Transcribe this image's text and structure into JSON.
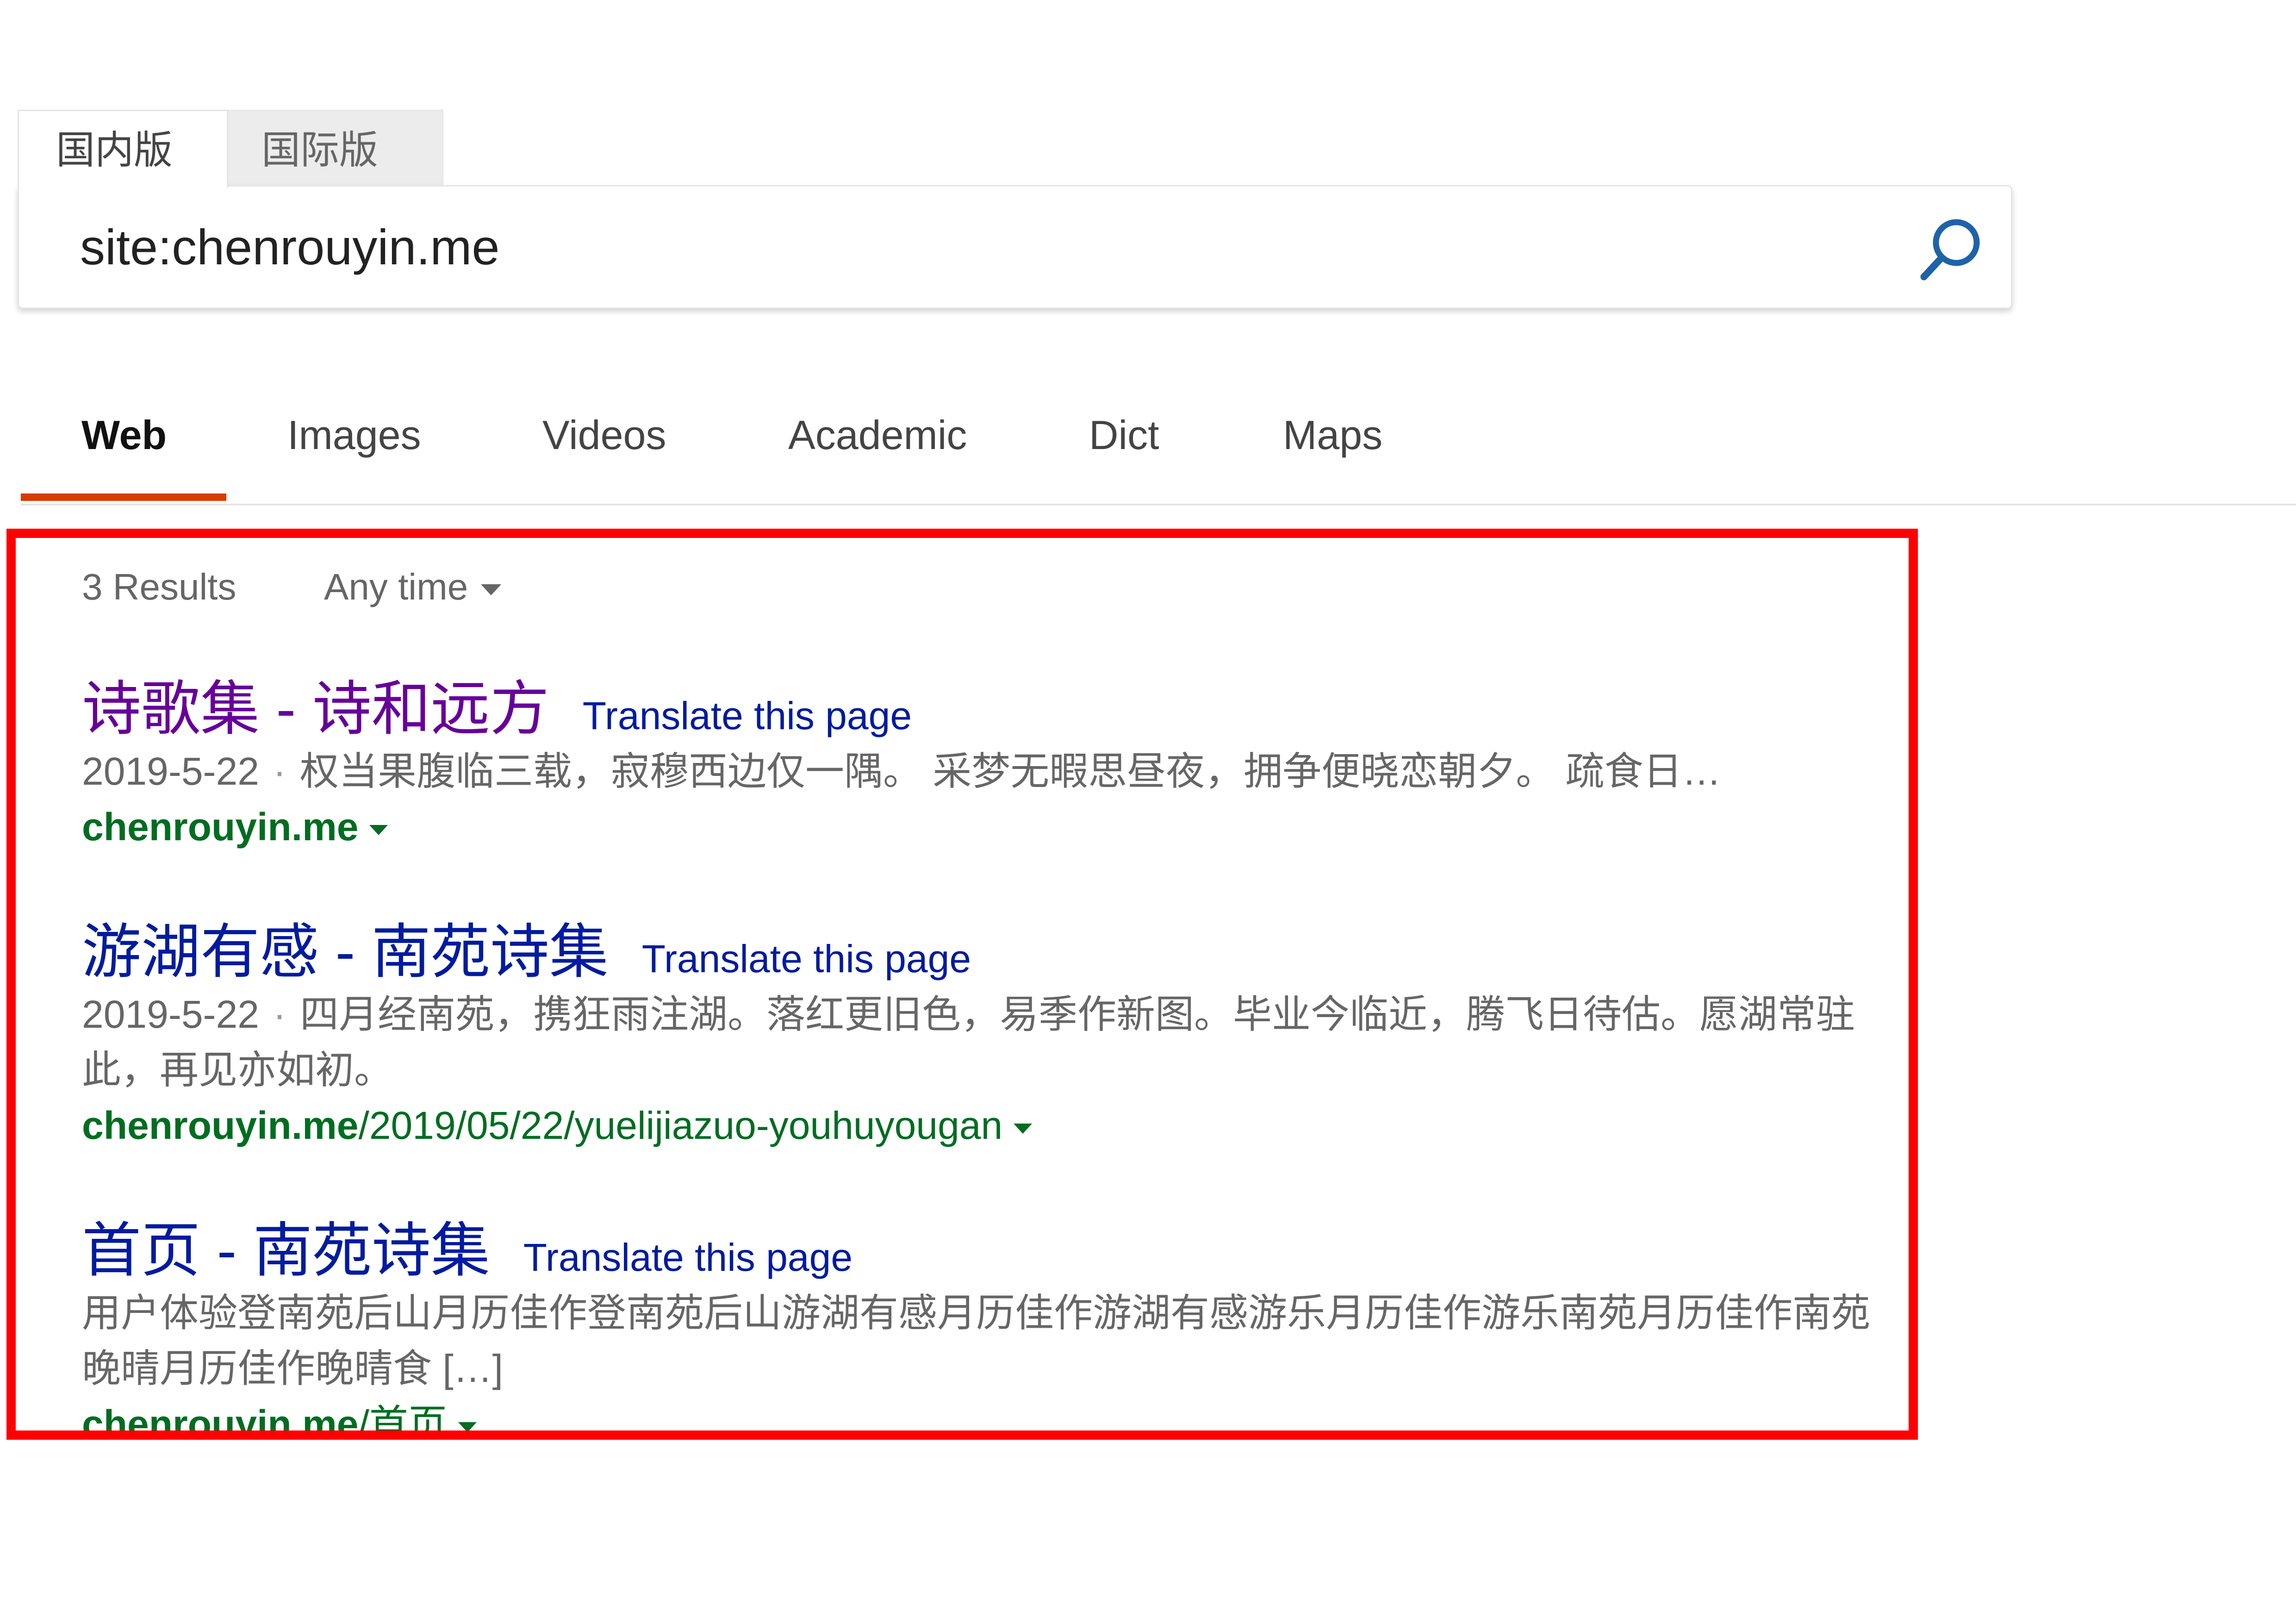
{
  "market_tabs": [
    {
      "label": "国内版",
      "active": true
    },
    {
      "label": "国际版",
      "active": false
    }
  ],
  "search": {
    "query": "site:chenrouyin.me",
    "icon": "search-icon"
  },
  "scope_nav": [
    "Web",
    "Images",
    "Videos",
    "Academic",
    "Dict",
    "Maps"
  ],
  "filters": {
    "count": "3 Results",
    "time": "Any time"
  },
  "results": [
    {
      "title": "诗歌集 - 诗和远方",
      "translate": "Translate this page",
      "date": "2019-5-22",
      "snippet": "权当果腹临三载，寂穆西边仅一隅。 采梦无暇思昼夜，拥争便晓恋朝夕。 疏食日…",
      "url_domain": "chenrouyin.me",
      "url_path": ""
    },
    {
      "title": "游湖有感 - 南苑诗集",
      "translate": "Translate this page",
      "date": "2019-5-22",
      "snippet": "四月经南苑，携狂雨注湖。落红更旧色，易季作新图。毕业今临近，腾飞日待估。愿湖常驻此，再见亦如初。",
      "url_domain": "chenrouyin.me",
      "url_path": "/2019/05/22/yuelijiazuo-youhuyougan"
    },
    {
      "title": "首页 - 南苑诗集",
      "translate": "Translate this page",
      "date": "",
      "snippet": "用户体验登南苑后山月历佳作登南苑后山游湖有感月历佳作游湖有感游乐月历佳作游乐南苑月历佳作南苑晚晴月历佳作晚晴食 […]",
      "url_domain": "chenrouyin.me",
      "url_path": "/首页"
    }
  ],
  "colors": {
    "link": "#001ba0",
    "visited_link": "#660099",
    "url_green": "#006d21",
    "active_underline": "#d83b01",
    "highlight_box": "#ff0000"
  }
}
